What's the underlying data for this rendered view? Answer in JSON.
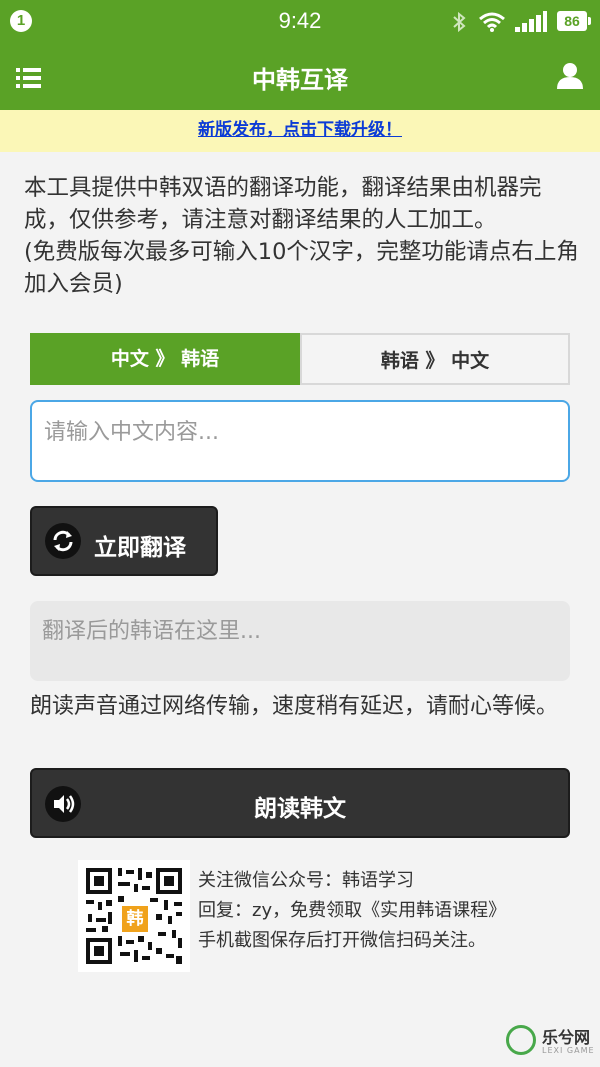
{
  "status_bar": {
    "notification_count": "1",
    "time": "9:42",
    "battery": "86"
  },
  "header": {
    "title": "中韩互译",
    "menu_icon": "list-icon",
    "user_icon": "user-icon"
  },
  "notice": {
    "text": "新版发布，点击下载升级！"
  },
  "description": {
    "line1": "本工具提供中韩双语的翻译功能，翻译结果由机器完成，仅供参考，请注意对翻译结果的人工加工。",
    "line2": "(免费版每次最多可输入10个汉字，完整功能请点右上角加入会员)"
  },
  "tabs": [
    {
      "label": "中文 》 韩语",
      "active": true
    },
    {
      "label": "韩语 》 中文",
      "active": false
    }
  ],
  "input": {
    "placeholder": "请输入中文内容...",
    "value": ""
  },
  "translate_button": {
    "label": "立即翻译",
    "icon": "refresh-icon"
  },
  "output": {
    "placeholder": "翻译后的韩语在这里..."
  },
  "read_note": "朗读声音通过网络传输，速度稍有延迟，请耐心等候。",
  "read_button": {
    "label": "朗读韩文",
    "icon": "speaker-icon"
  },
  "wechat": {
    "qr_badge": "韩",
    "line1": "关注微信公众号：韩语学习",
    "line2": "回复：zy，免费领取《实用韩语课程》",
    "line3": "手机截图保存后打开微信扫码关注。"
  },
  "watermark": {
    "text": "乐兮网",
    "sub": "LEXI GAME"
  },
  "colors": {
    "brand_green": "#5aa226",
    "notice_bg": "#fbf7b7",
    "link_blue": "#0b3bd6",
    "input_border": "#4ba7e6",
    "dark_button": "#333333"
  }
}
